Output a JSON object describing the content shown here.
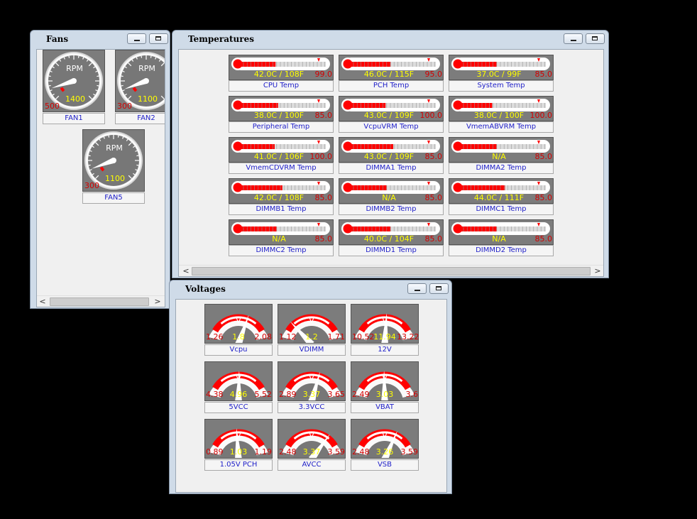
{
  "windows": {
    "fans": {
      "title": "Fans"
    },
    "temperatures": {
      "title": "Temperatures"
    },
    "voltages": {
      "title": "Voltages"
    }
  },
  "scroll_arrows": {
    "left": "<",
    "right": ">"
  },
  "fans": [
    {
      "label": "FAN1",
      "unit": "RPM",
      "value": "1400",
      "min": "500",
      "fraction": 0.1
    },
    {
      "label": "FAN2",
      "unit": "RPM",
      "value": "1100",
      "min": "300",
      "fraction": 0.09
    },
    {
      "label": "FAN5",
      "unit": "RPM",
      "value": "1100",
      "min": "300",
      "fraction": 0.09
    }
  ],
  "temperatures": [
    {
      "label": "CPU Temp",
      "reading": "42.0C / 108F",
      "max": "99.0",
      "fraction": 0.41
    },
    {
      "label": "PCH Temp",
      "reading": "46.0C / 115F",
      "max": "95.0",
      "fraction": 0.47
    },
    {
      "label": "System Temp",
      "reading": "37.0C / 99F",
      "max": "85.0",
      "fraction": 0.42
    },
    {
      "label": "Peripheral Temp",
      "reading": "38.0C / 100F",
      "max": "85.0",
      "fraction": 0.44
    },
    {
      "label": "VcpuVRM Temp",
      "reading": "43.0C / 109F",
      "max": "100.0",
      "fraction": 0.41
    },
    {
      "label": "VmemABVRM Temp",
      "reading": "38.0C / 100F",
      "max": "100.0",
      "fraction": 0.37
    },
    {
      "label": "VmemCDVRM Temp",
      "reading": "41.0C / 106F",
      "max": "100.0",
      "fraction": 0.4
    },
    {
      "label": "DIMMA1 Temp",
      "reading": "43.0C / 109F",
      "max": "85.0",
      "fraction": 0.5
    },
    {
      "label": "DIMMA2 Temp",
      "reading": "N/A",
      "max": "85.0",
      "fraction": 0.42
    },
    {
      "label": "DIMMB1 Temp",
      "reading": "42.0C / 108F",
      "max": "85.0",
      "fraction": 0.49
    },
    {
      "label": "DIMMB2 Temp",
      "reading": "N/A",
      "max": "85.0",
      "fraction": 0.42
    },
    {
      "label": "DIMMC1 Temp",
      "reading": "44.0C / 111F",
      "max": "85.0",
      "fraction": 0.52
    },
    {
      "label": "DIMMC2 Temp",
      "reading": "N/A",
      "max": "85.0",
      "fraction": 0.42
    },
    {
      "label": "DIMMD1 Temp",
      "reading": "40.0C / 104F",
      "max": "85.0",
      "fraction": 0.47
    },
    {
      "label": "DIMMD2 Temp",
      "reading": "N/A",
      "max": "85.0",
      "fraction": 0.42
    }
  ],
  "voltages": [
    {
      "label": "Vcpu",
      "unit": "V",
      "value": "1.8",
      "min": "1.26",
      "max": "2.08",
      "fraction": 0.66
    },
    {
      "label": "VDIMM",
      "unit": "V",
      "value": "1.2",
      "min": "1.12",
      "max": "1.71",
      "fraction": 0.14
    },
    {
      "label": "12V",
      "unit": "V",
      "value": "11.94",
      "min": "10.52",
      "max": "13.22",
      "fraction": 0.53
    },
    {
      "label": "5VCC",
      "unit": "V",
      "value": "4.96",
      "min": "4.38",
      "max": "5.52",
      "fraction": 0.51
    },
    {
      "label": "3.3VCC",
      "unit": "V",
      "value": "3.37",
      "min": "2.89",
      "max": "3.65",
      "fraction": 0.63
    },
    {
      "label": "VBAT",
      "unit": "V",
      "value": "3.03",
      "min": "2.49",
      "max": "3.6",
      "fraction": 0.49
    },
    {
      "label": "1.05V PCH",
      "unit": "V",
      "value": "1.03",
      "min": "0.89",
      "max": "1.19",
      "fraction": 0.47
    },
    {
      "label": "AVCC",
      "unit": "V",
      "value": "3.37",
      "min": "2.48",
      "max": "3.59",
      "fraction": 0.8
    },
    {
      "label": "VSB",
      "unit": "V",
      "value": "3.26",
      "min": "2.48",
      "max": "3.59",
      "fraction": 0.7
    }
  ],
  "colors": {
    "gauge_bg": "#7c7c7c",
    "red": "#ff0000",
    "value_text": "#ffff00",
    "label_text": "#1e1ec8"
  }
}
